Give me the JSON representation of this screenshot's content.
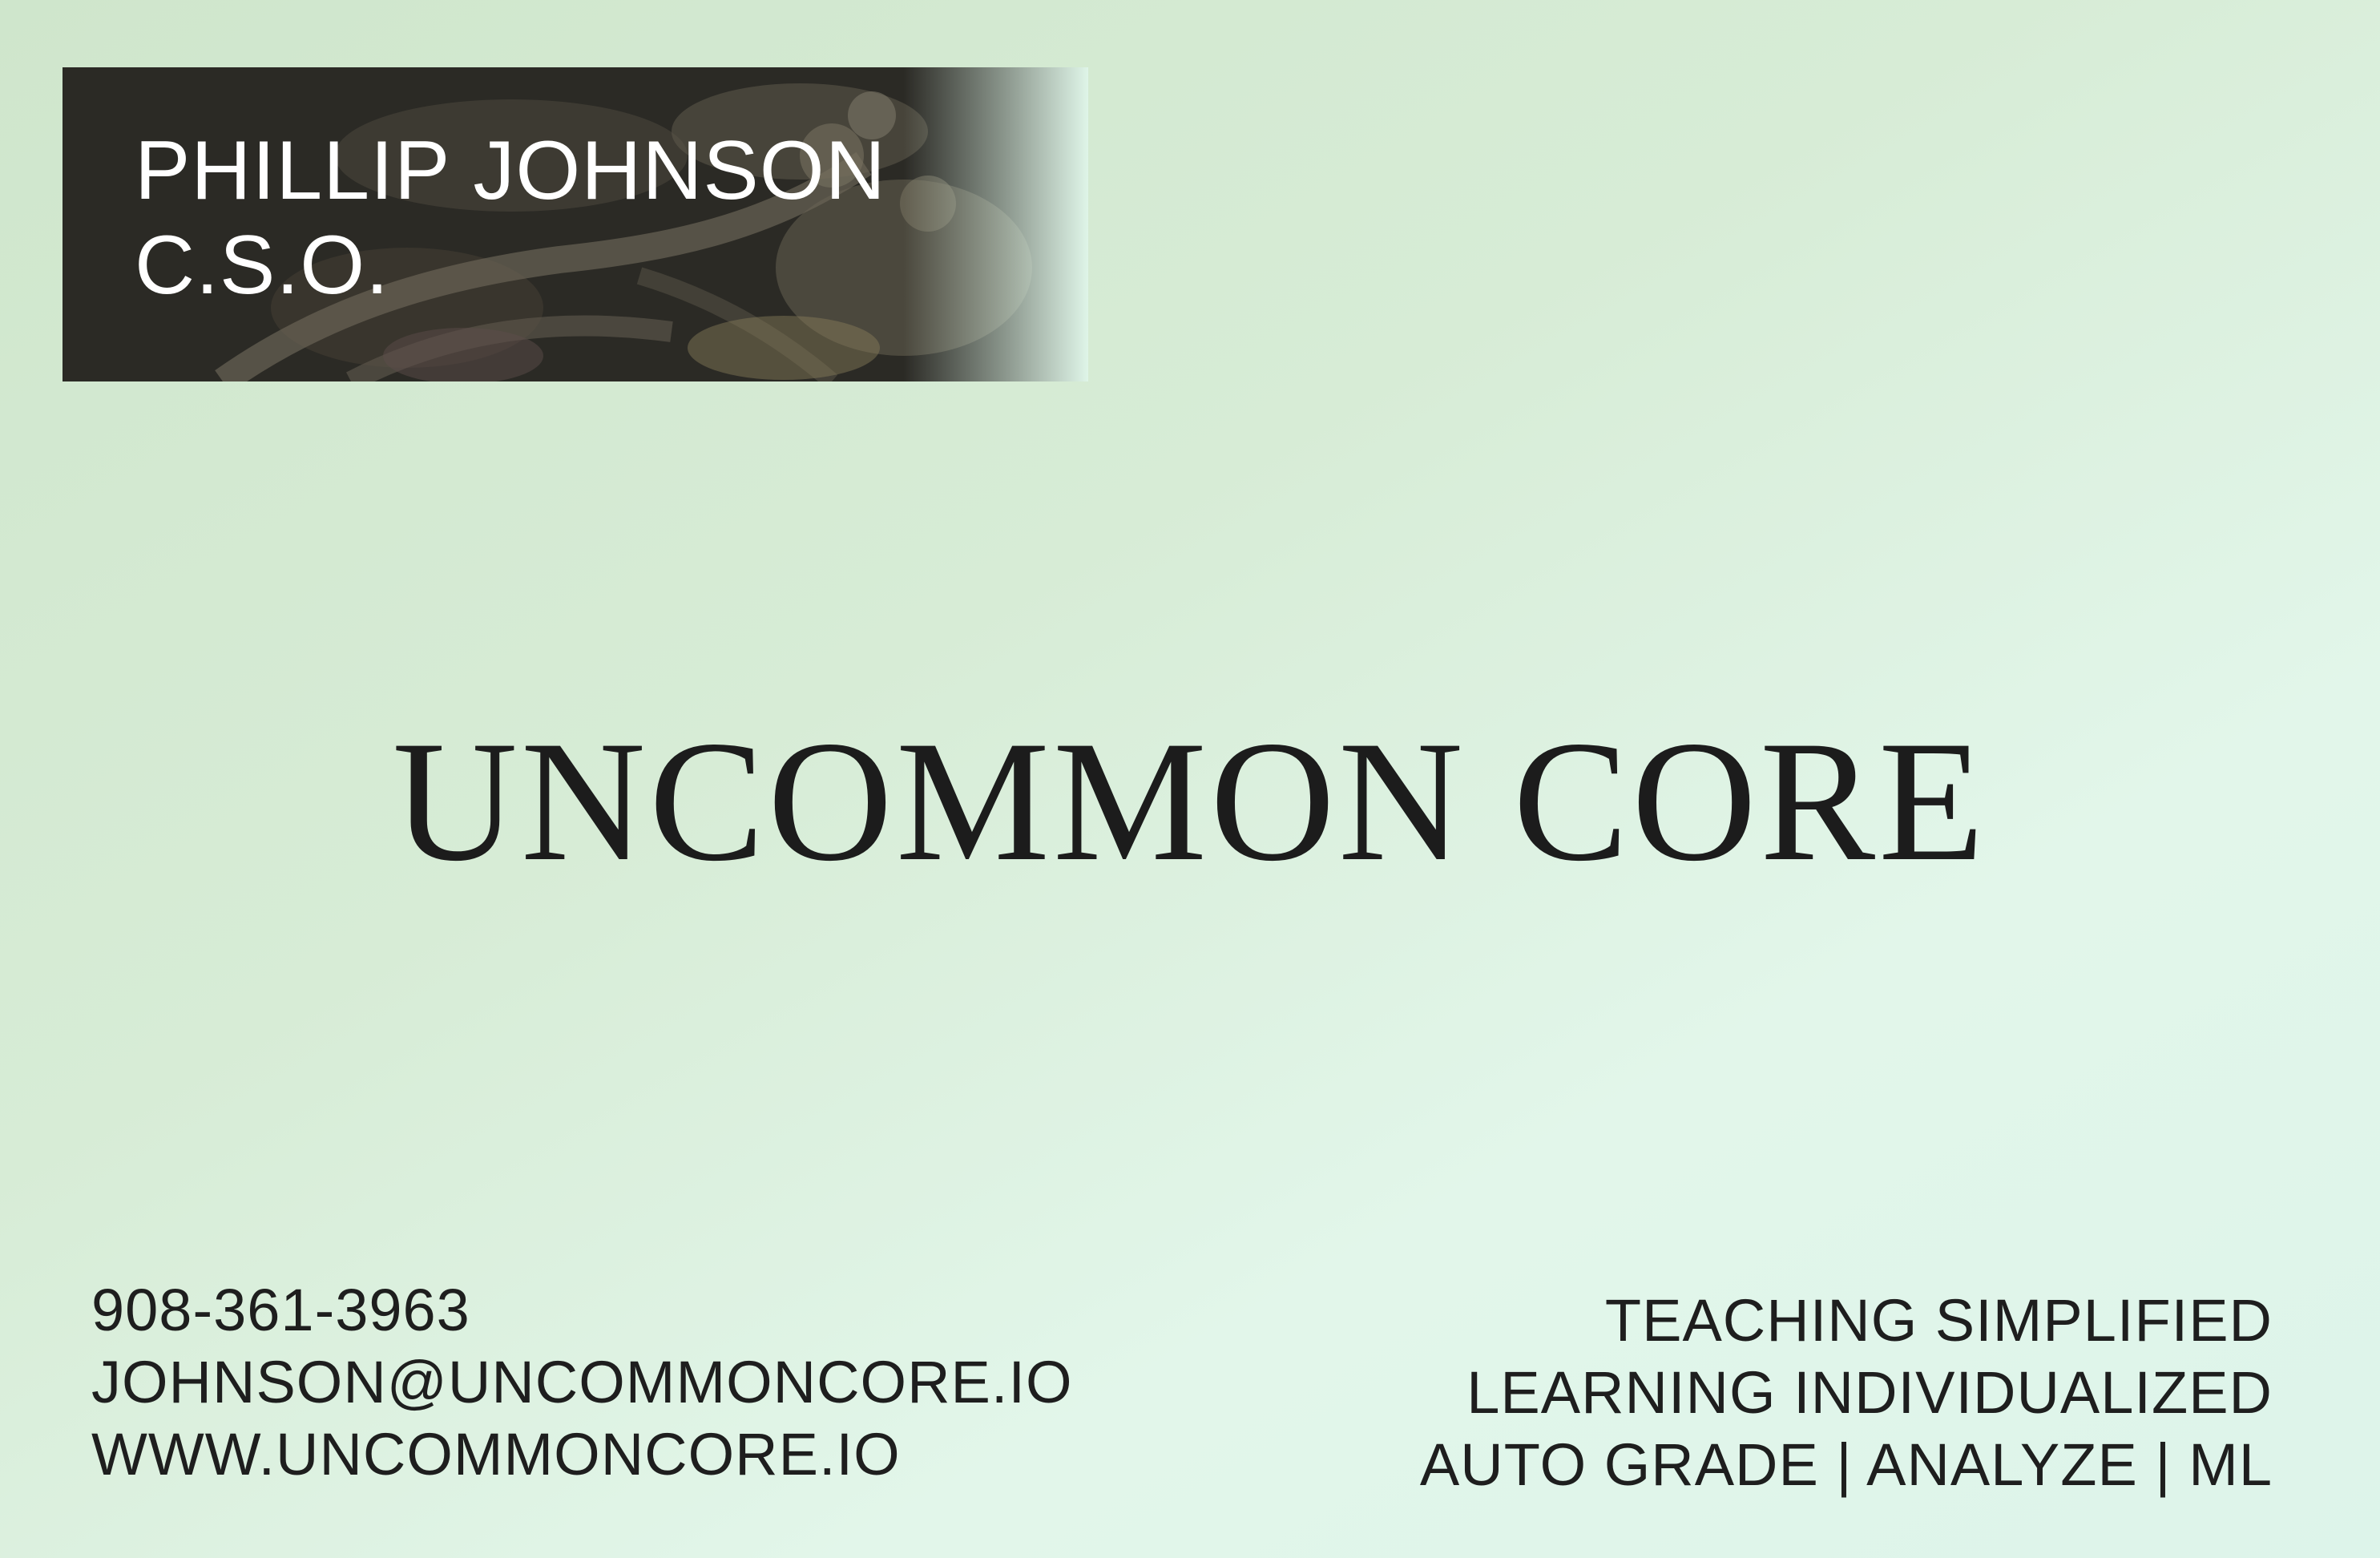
{
  "card": {
    "name": "PHILLIP JOHNSON",
    "title": "C.S.O.",
    "company": "UNCOMMON CORE",
    "contact": {
      "phone": "908-361-3963",
      "email": "JOHNSON@UNCOMMONCORE.IO",
      "website": "WWW.UNCOMMONCORE.IO"
    },
    "taglines": [
      "TEACHING SIMPLIFIED",
      "LEARNING INDIVIDUALIZED",
      "AUTO GRADE | ANALYZE | ML"
    ]
  },
  "colors": {
    "background": "#d7ecd6",
    "banner": "#252522",
    "banner_text": "#ffffff",
    "text": "#1e1e1e"
  }
}
